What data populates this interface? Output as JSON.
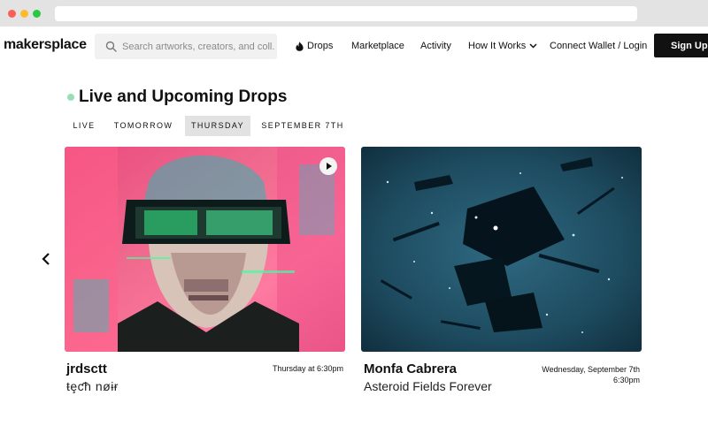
{
  "header": {
    "logo": "makersplace",
    "search_placeholder": "Search artworks, creators, and coll...",
    "nav": {
      "drops": "Drops",
      "marketplace": "Marketplace",
      "activity": "Activity",
      "how_it_works": "How It Works",
      "connect_wallet": "Connect Wallet / Login"
    },
    "sign_up": "Sign Up"
  },
  "section": {
    "title": "Live and Upcoming Drops",
    "tabs": [
      {
        "label": "LIVE",
        "selected": false
      },
      {
        "label": "TOMORROW",
        "selected": false
      },
      {
        "label": "THURSDAY",
        "selected": true
      },
      {
        "label": "SEPTEMBER 7TH",
        "selected": false
      }
    ]
  },
  "drops": [
    {
      "creator": "jrdsctt",
      "title": "ŧȩƈħ nøɨɍ",
      "time": "Thursday at 6:30pm",
      "has_video": true
    },
    {
      "creator": "Monfa Cabrera",
      "title": "Asteroid Fields Forever",
      "time_line1": "Wednesday, September 7th",
      "time_line2": "6:30pm",
      "has_video": false
    }
  ],
  "colors": {
    "live_dot": "#9adfb4",
    "sign_up_bg": "#111111",
    "selected_tab_bg": "#e2e2e2"
  }
}
